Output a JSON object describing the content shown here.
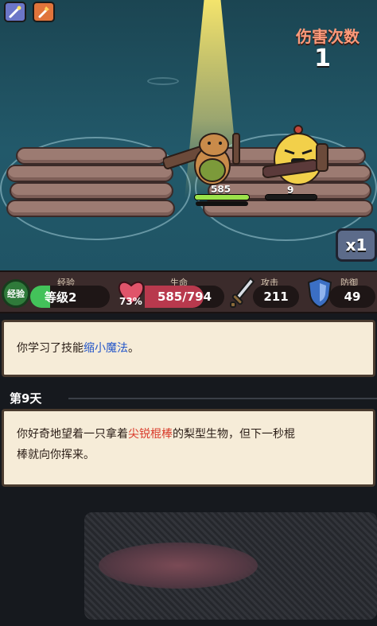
{
  "skills": [
    {
      "icon": "wand-icon",
      "color": "#6b76c8"
    },
    {
      "icon": "torch-icon",
      "color": "#e0743b"
    }
  ],
  "damage": {
    "title": "伤害次数",
    "count": "1"
  },
  "player": {
    "hp": "585",
    "hp_ratio": 1.0
  },
  "enemy": {
    "hp": "9",
    "hp_ratio": 1.0
  },
  "speed": "x1",
  "stats": {
    "exp": {
      "badge": "经验",
      "label": "经验",
      "value": "等级2",
      "bar_ratio": 0.25
    },
    "life": {
      "label": "生命",
      "percent": "73%",
      "value": "585/794",
      "bar_ratio": 0.737
    },
    "attack": {
      "label": "攻击",
      "value": "211"
    },
    "defense": {
      "label": "防御",
      "value": "49"
    }
  },
  "log": {
    "msg1": {
      "prefix": "你学习了技能",
      "highlight": "缩小魔法",
      "suffix": "。"
    },
    "day": "第9天",
    "msg2": {
      "prefix": "你好奇地望着一只拿着",
      "highlight": "尖锐棍棒",
      "mid": "的梨型生物，但下一秒棍",
      "line2": "棒就向你挥来。"
    }
  },
  "colors": {
    "accent_blue": "#2456c9",
    "accent_red": "#d93a2a",
    "hp_green": "#9be24a",
    "life_pink": "#e0546a"
  }
}
